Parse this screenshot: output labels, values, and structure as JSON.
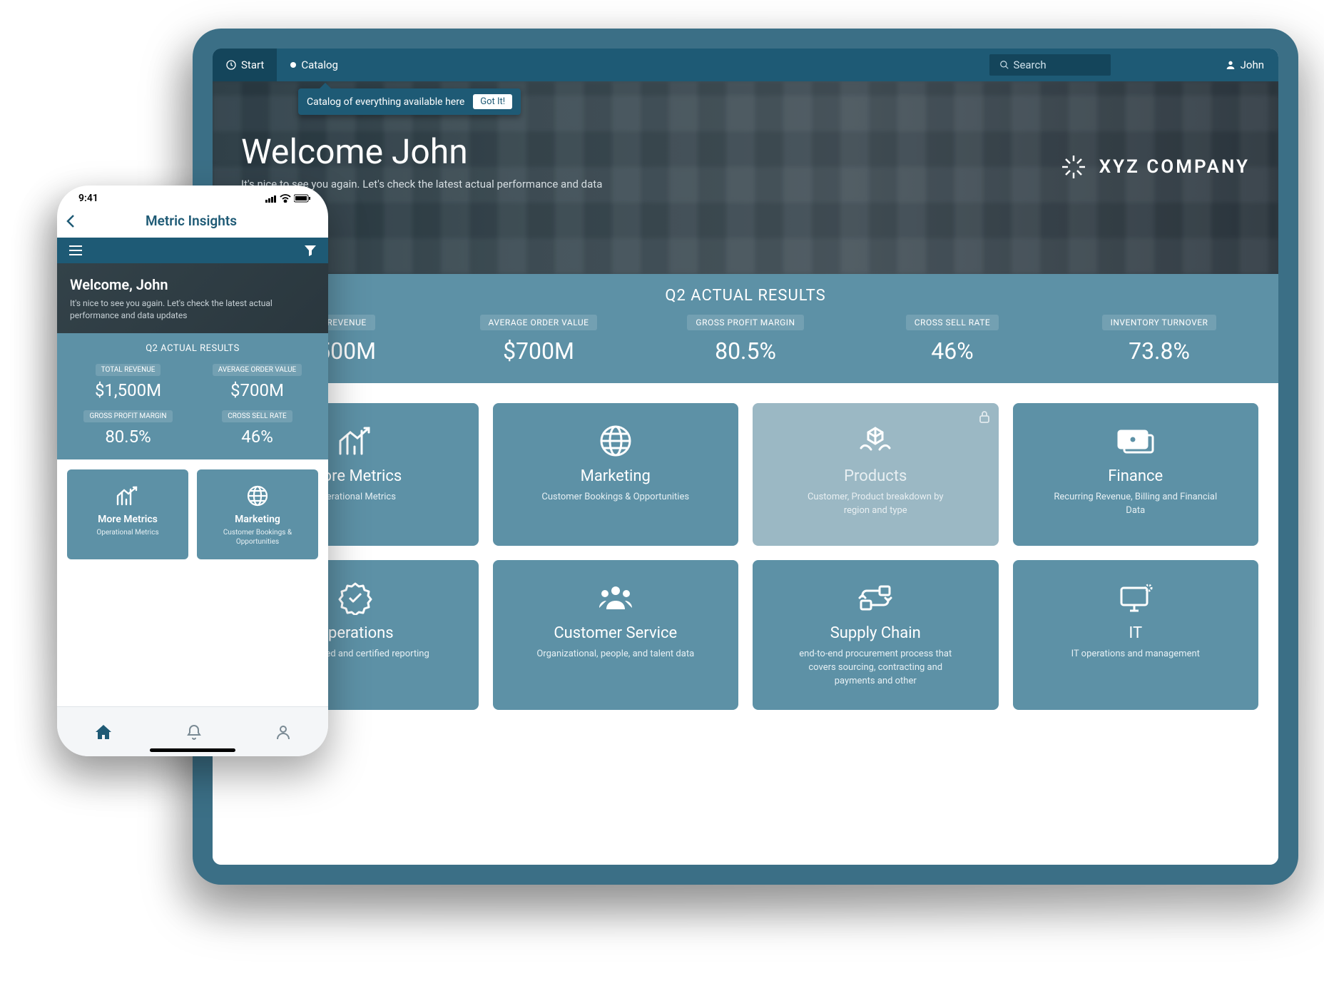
{
  "tablet": {
    "nav": {
      "start": "Start",
      "catalog": "Catalog",
      "search": "Search",
      "user": "John"
    },
    "tooltip": {
      "text": "Catalog of everything available here",
      "button": "Got It!"
    },
    "hero": {
      "title": "Welcome John",
      "subtitle": "It's nice to see you again. Let's check the latest actual performance and data",
      "company": "XYZ COMPANY"
    },
    "kpi": {
      "title": "Q2 ACTUAL RESULTS",
      "items": [
        {
          "label": "TOTAL REVENUE",
          "value": "$1,500M"
        },
        {
          "label": "AVERAGE ORDER VALUE",
          "value": "$700M"
        },
        {
          "label": "GROSS PROFIT MARGIN",
          "value": "80.5%"
        },
        {
          "label": "CROSS SELL RATE",
          "value": "46%"
        },
        {
          "label": "INVENTORY TURNOVER",
          "value": "73.8%"
        }
      ]
    },
    "tiles": [
      {
        "title": "More Metrics",
        "desc": "Operational Metrics",
        "icon": "chart-trend-icon",
        "locked": false
      },
      {
        "title": "Marketing",
        "desc": "Customer Bookings & Opportunities",
        "icon": "globe-icon",
        "locked": false
      },
      {
        "title": "Products",
        "desc": "Customer, Product breakdown by region and type",
        "icon": "hands-product-icon",
        "locked": true
      },
      {
        "title": "Finance",
        "desc": "Recurring Revenue, Billing and Financial Data",
        "icon": "money-icon",
        "locked": false
      },
      {
        "title": "Operations",
        "desc": "Standardized and certified reporting",
        "icon": "badge-check-icon",
        "locked": false
      },
      {
        "title": "Customer Service",
        "desc": "Organizational, people, and talent data",
        "icon": "people-icon",
        "locked": false
      },
      {
        "title": "Supply Chain",
        "desc": "end-to-end procurement process that covers sourcing, contracting and payments and other",
        "icon": "cycle-icon",
        "locked": false
      },
      {
        "title": "IT",
        "desc": "IT operations and management",
        "icon": "monitor-icon",
        "locked": false
      }
    ]
  },
  "phone": {
    "status_time": "9:41",
    "app_title": "Metric Insights",
    "hero": {
      "title": "Welcome, John",
      "subtitle": "It's nice to see you again. Let's check the latest actual performance and data updates"
    },
    "kpi": {
      "title": "Q2 ACTUAL RESULTS",
      "items": [
        {
          "label": "TOTAL REVENUE",
          "value": "$1,500M"
        },
        {
          "label": "AVERAGE ORDER VALUE",
          "value": "$700M"
        },
        {
          "label": "GROSS PROFIT MARGIN",
          "value": "80.5%"
        },
        {
          "label": "CROSS SELL RATE",
          "value": "46%"
        }
      ]
    },
    "tiles": [
      {
        "title": "More Metrics",
        "desc": "Operational Metrics",
        "icon": "chart-trend-icon"
      },
      {
        "title": "Marketing",
        "desc": "Customer Bookings & Opportunities",
        "icon": "globe-icon"
      }
    ]
  }
}
